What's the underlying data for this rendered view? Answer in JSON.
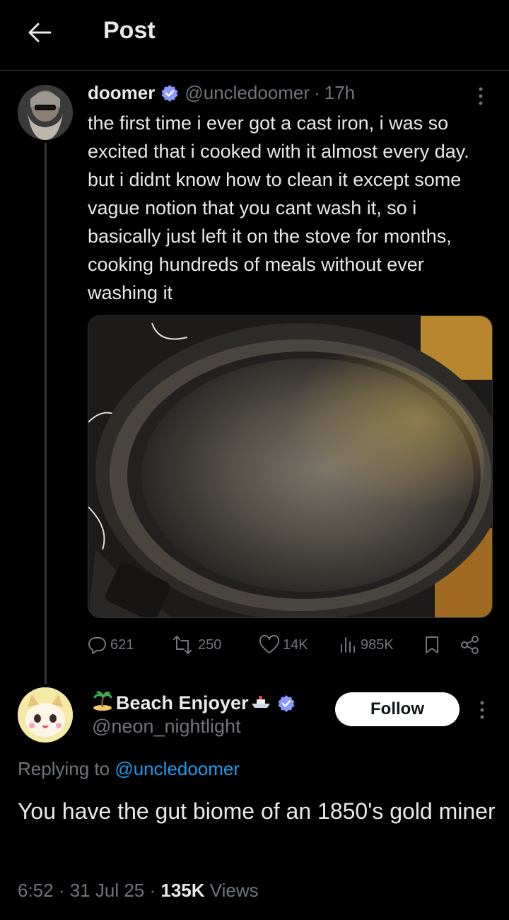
{
  "header": {
    "title": "Post"
  },
  "post": {
    "author_name": "doomer",
    "author_handle": "@uncledoomer",
    "time_ago": "17h",
    "text": "the first time i ever got a cast iron, i was so excited that i cooked with it almost every day. but i didnt know how to clean it except some vague notion that you cant wash it, so i basically just left it on the stove for months, cooking hundreds of meals without ever washing it",
    "stats": {
      "replies": "621",
      "reposts": "250",
      "likes": "14K",
      "views": "985K"
    }
  },
  "reply": {
    "author_name": "Beach Enjoyer",
    "author_handle": "@neon_nightlight",
    "follow_label": "Follow",
    "replying_prefix": "Replying to",
    "replying_to": "@uncledoomer",
    "text": "You have the gut biome of an 1850's gold miner",
    "time": "6:52",
    "date": "31 Jul 25",
    "views_count": "135K",
    "views_label": "Views"
  },
  "colors": {
    "background": "#000000",
    "text": "#e7e9ea",
    "muted": "#71767b",
    "accent": "#1d9bf0",
    "verified": "#8b98ff"
  }
}
